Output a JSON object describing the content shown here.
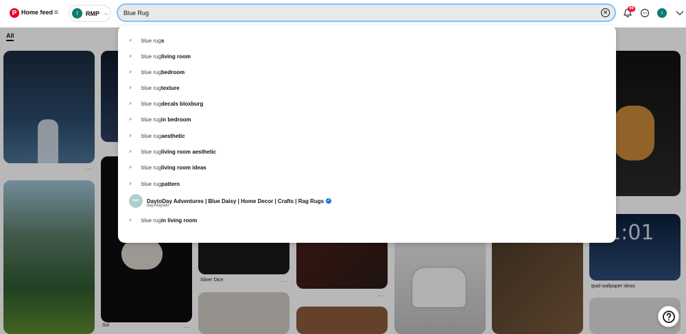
{
  "header": {
    "logo_icon": "pinterest-logo",
    "feed_label": "Home feed",
    "feed_menu_icon": "≡",
    "board": {
      "avatar_initial": "I",
      "name": "RMP",
      "chevron_icon": "chevron-down-icon"
    },
    "search": {
      "value": "Blue Rug",
      "clear_icon": "✕"
    },
    "notifications": {
      "badge": "99"
    },
    "profile_initial": "I"
  },
  "tabs": {
    "active": "All"
  },
  "suggestions": [
    {
      "prefix": "blue rug",
      "bold": "s"
    },
    {
      "prefix": "blue rug ",
      "bold": "living room"
    },
    {
      "prefix": "blue rug ",
      "bold": "bedroom"
    },
    {
      "prefix": "blue rug ",
      "bold": "texture"
    },
    {
      "prefix": "blue rug ",
      "bold": "decals bloxburg"
    },
    {
      "prefix": "blue rug ",
      "bold": "in bedroom"
    },
    {
      "prefix": "blue rug ",
      "bold": "aesthetic"
    },
    {
      "prefix": "blue rug ",
      "bold": "living room aesthetic"
    },
    {
      "prefix": "blue rug ",
      "bold": "living room ideas"
    },
    {
      "prefix": "blue rug ",
      "bold": "pattern"
    }
  ],
  "profile_suggestion": {
    "name": "DaytoDay Adventures | Blue Daisy | Home Decor | Crafts | Rag Rugs",
    "handle": "day2dayadv",
    "avatar_text": "RMP"
  },
  "last_suggestion": {
    "prefix": "blue rug ",
    "bold": "in living room"
  },
  "pins": {
    "sol": "Sol",
    "silver_dice": "Silver Dice",
    "ipad": "ipad wallpaper ideas",
    "more": "···"
  },
  "help_icon": "?",
  "colors": {
    "brand": "#e60023",
    "focus": "#7fc1ff",
    "avatar": "#0b7d72"
  }
}
